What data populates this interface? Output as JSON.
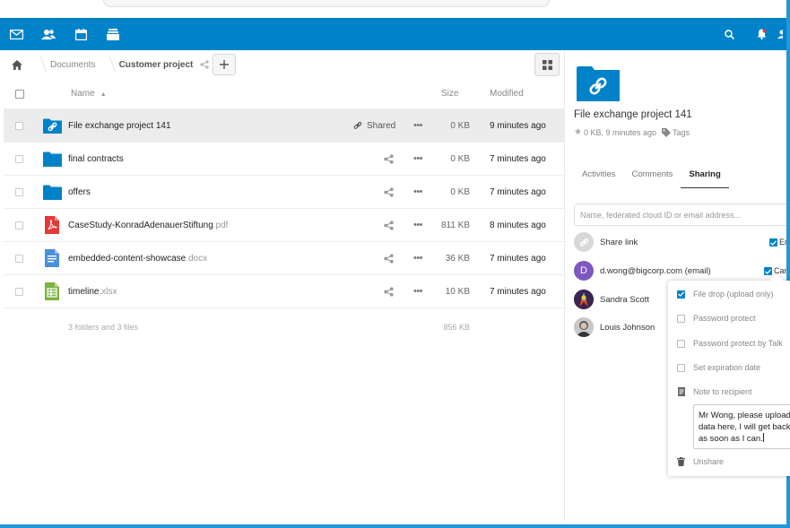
{
  "breadcrumb": {
    "items": [
      "Documents",
      "Customer project"
    ]
  },
  "filelist": {
    "columns": {
      "name": "Name",
      "size": "Size",
      "modified": "Modified"
    },
    "rows": [
      {
        "name": "File exchange project 141",
        "ext": "",
        "type": "shared-folder",
        "share": "Shared",
        "size": "0 KB",
        "modified": "9 minutes ago"
      },
      {
        "name": "final contracts",
        "ext": "",
        "type": "folder",
        "share": "",
        "size": "0 KB",
        "modified": "7 minutes ago"
      },
      {
        "name": "offers",
        "ext": "",
        "type": "folder",
        "share": "",
        "size": "0 KB",
        "modified": "7 minutes ago"
      },
      {
        "name": "CaseStudy-KonradAdenauerStiftung",
        "ext": ".pdf",
        "type": "pdf",
        "share": "",
        "size": "811 KB",
        "modified": "8 minutes ago"
      },
      {
        "name": "embedded-content-showcase",
        "ext": ".docx",
        "type": "doc",
        "share": "",
        "size": "36 KB",
        "modified": "7 minutes ago"
      },
      {
        "name": "timeline",
        "ext": ".xlsx",
        "type": "sheet",
        "share": "",
        "size": "10 KB",
        "modified": "7 minutes ago"
      }
    ],
    "summary": {
      "text": "3 folders and 3 files",
      "size": "856 KB"
    }
  },
  "sidebar": {
    "title": "File exchange project 141",
    "meta": "0 KB, 9 minutes ago",
    "tags_label": "Tags",
    "tabs": [
      "Activities",
      "Comments",
      "Sharing"
    ],
    "share_placeholder": "Name, federated cloud ID or email address...",
    "share_link_label": "Share link",
    "share_link_option": "En",
    "shares": [
      {
        "name": "d.wong@bigcorp.com (email)",
        "avatar": "D",
        "option": "Can"
      },
      {
        "name": "Sandra Scott",
        "avatar": ""
      },
      {
        "name": "Louis Johnson",
        "avatar": ""
      }
    ]
  },
  "popover": {
    "file_drop": "File drop (upload only)",
    "password_protect": "Password protect",
    "password_protect_talk": "Password protect by Talk",
    "expiration": "Set expiration date",
    "note_label": "Note to recipient",
    "note_text": "Mr Wong, please upload\ndata here, I will get back\nas soon as I can.",
    "unshare": "Unshare"
  },
  "colors": {
    "header": "#0082c9",
    "folder": "#0082c9",
    "pdf": "#e53935",
    "doc": "#4a90d9",
    "sheet": "#7cb342",
    "frame": "#2196d8"
  }
}
